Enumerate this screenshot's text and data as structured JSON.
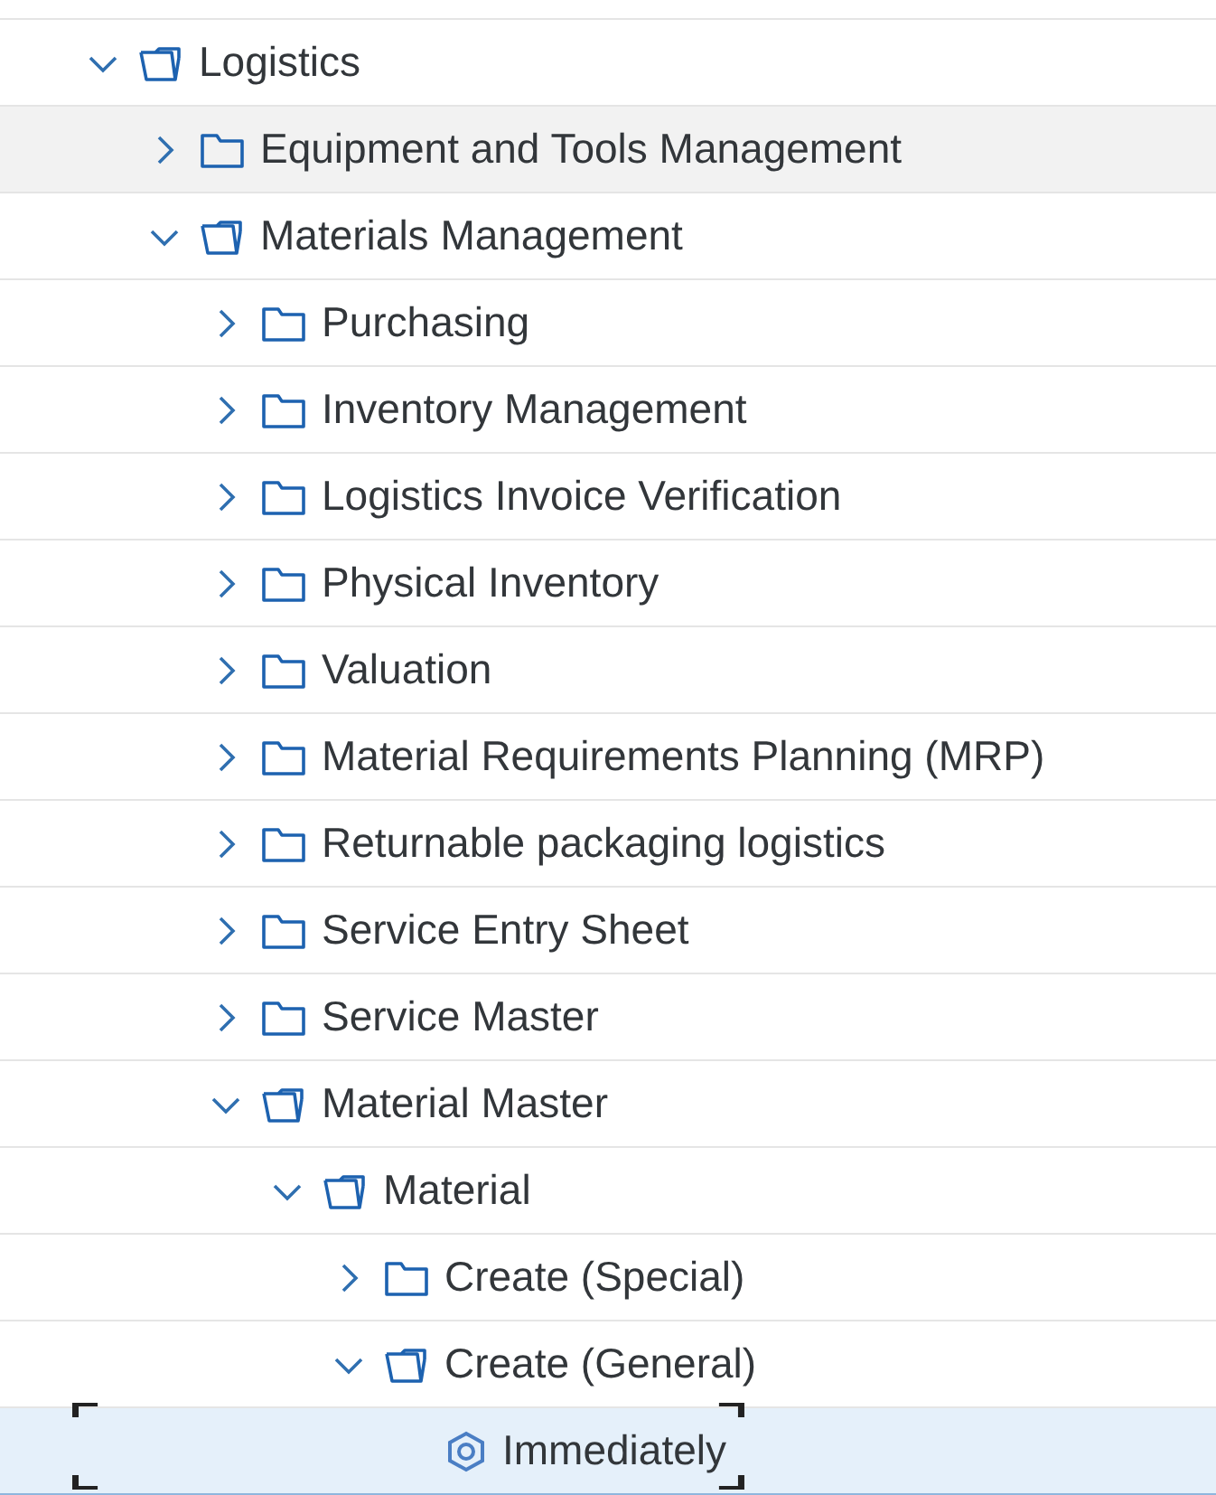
{
  "tree": [
    {
      "label": "Logistics",
      "kind": "folder",
      "expanded": true,
      "selected": false,
      "hovered": false,
      "children": [
        {
          "label": "Equipment and Tools Management",
          "kind": "folder",
          "expanded": false,
          "selected": false,
          "hovered": true
        },
        {
          "label": "Materials Management",
          "kind": "folder",
          "expanded": true,
          "selected": false,
          "hovered": false,
          "children": [
            {
              "label": "Purchasing",
              "kind": "folder",
              "expanded": false,
              "selected": false,
              "hovered": false
            },
            {
              "label": "Inventory Management",
              "kind": "folder",
              "expanded": false,
              "selected": false,
              "hovered": false
            },
            {
              "label": "Logistics Invoice Verification",
              "kind": "folder",
              "expanded": false,
              "selected": false,
              "hovered": false
            },
            {
              "label": "Physical Inventory",
              "kind": "folder",
              "expanded": false,
              "selected": false,
              "hovered": false
            },
            {
              "label": "Valuation",
              "kind": "folder",
              "expanded": false,
              "selected": false,
              "hovered": false
            },
            {
              "label": "Material Requirements Planning (MRP)",
              "kind": "folder",
              "expanded": false,
              "selected": false,
              "hovered": false
            },
            {
              "label": "Returnable packaging logistics",
              "kind": "folder",
              "expanded": false,
              "selected": false,
              "hovered": false
            },
            {
              "label": "Service Entry Sheet",
              "kind": "folder",
              "expanded": false,
              "selected": false,
              "hovered": false
            },
            {
              "label": "Service Master",
              "kind": "folder",
              "expanded": false,
              "selected": false,
              "hovered": false
            },
            {
              "label": "Material Master",
              "kind": "folder",
              "expanded": true,
              "selected": false,
              "hovered": false,
              "children": [
                {
                  "label": "Material",
                  "kind": "folder",
                  "expanded": true,
                  "selected": false,
                  "hovered": false,
                  "children": [
                    {
                      "label": "Create (Special)",
                      "kind": "folder",
                      "expanded": false,
                      "selected": false,
                      "hovered": false
                    },
                    {
                      "label": "Create (General)",
                      "kind": "folder",
                      "expanded": true,
                      "selected": false,
                      "hovered": false,
                      "children": [
                        {
                          "label": "Immediately",
                          "kind": "transaction",
                          "selected": true,
                          "hovered": false
                        }
                      ]
                    }
                  ]
                }
              ]
            }
          ]
        }
      ]
    }
  ]
}
